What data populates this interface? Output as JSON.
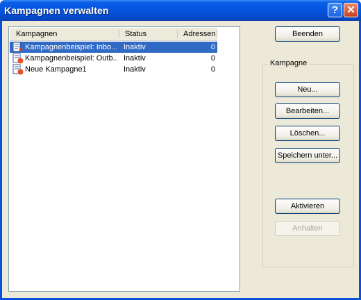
{
  "window": {
    "title": "Kampagnen verwalten",
    "help_label": "?",
    "close_label": "✕"
  },
  "list": {
    "columns": [
      "Kampagnen",
      "Status",
      "Adressen"
    ],
    "rows": [
      {
        "name": "Kampagnenbeispiel: Inbo...",
        "status": "Inaktiv",
        "addresses": "0",
        "selected": true,
        "icon": "inbound-campaign-icon"
      },
      {
        "name": "Kampagnenbeispiel: Outb...",
        "status": "Inaktiv",
        "addresses": "0",
        "selected": false,
        "icon": "outbound-campaign-icon"
      },
      {
        "name": "Neue Kampagne1",
        "status": "Inaktiv",
        "addresses": "0",
        "selected": false,
        "icon": "outbound-campaign-icon"
      }
    ]
  },
  "buttons": {
    "quit": "Beenden",
    "group_label": "Kampagne",
    "new": "Neu...",
    "edit": "Bearbeiten...",
    "delete": "Löschen...",
    "save_as": "Speichern unter...",
    "activate": "Aktivieren",
    "stop": "Anhalten"
  },
  "colors": {
    "selection": "#316ac5",
    "title_bar": "#0553dc",
    "face": "#ece9d8"
  }
}
